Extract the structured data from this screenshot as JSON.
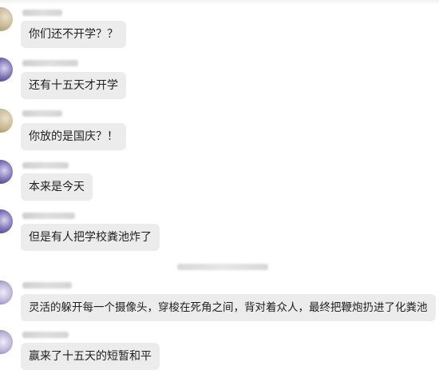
{
  "messages": [
    {
      "text": "你们还不开学？？"
    },
    {
      "text": "还有十五天才开学"
    },
    {
      "text": "你放的是国庆？！"
    },
    {
      "text": "本来是今天"
    },
    {
      "text": "但是有人把学校粪池炸了"
    },
    {
      "text": "灵活的躲开每一个摄像头，穿梭在死角之间，背对着众人，最终把鞭炮扔进了化粪池"
    },
    {
      "text": "赢来了十五天的短暂和平"
    }
  ]
}
